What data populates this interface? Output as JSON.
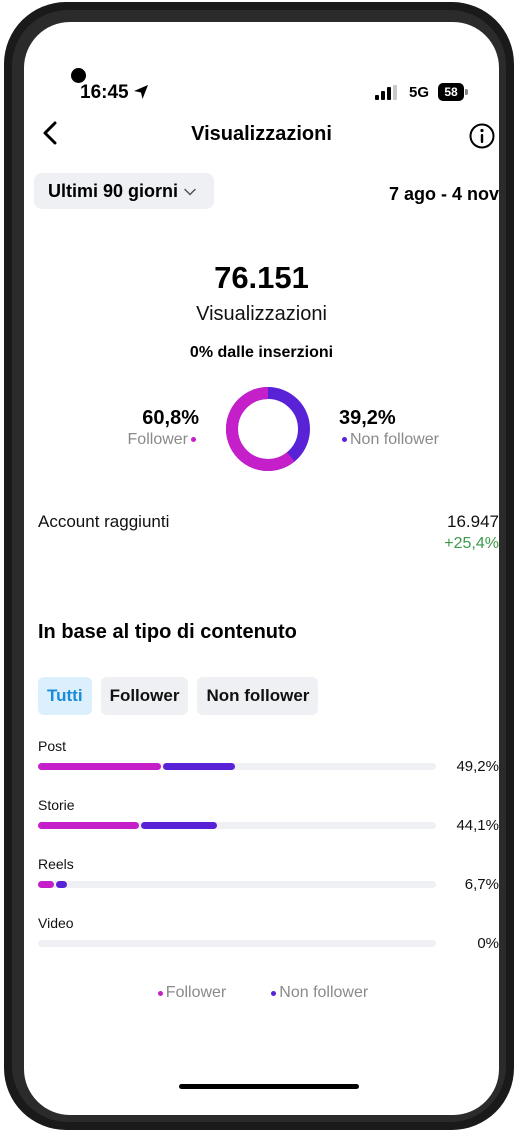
{
  "status_bar": {
    "time": "16:45",
    "network": "5G",
    "battery": "58"
  },
  "header": {
    "title": "Visualizzazioni"
  },
  "period": {
    "selected": "Ultimi 90 giorni",
    "date_range": "7 ago - 4 nov"
  },
  "summary": {
    "total": "76.151",
    "label": "Visualizzazioni",
    "ads_note": "0% dalle inserzioni",
    "follower_pct": "60,8%",
    "follower_label": "Follower",
    "non_follower_pct": "39,2%",
    "non_follower_label": "Non follower",
    "follower_fraction": 0.608
  },
  "reach": {
    "label": "Account raggiunti",
    "value": "16.947",
    "change": "+25,4%"
  },
  "content_section": {
    "title": "In base al tipo di contenuto",
    "tabs": [
      "Tutti",
      "Follower",
      "Non follower"
    ],
    "active_tab": "Tutti",
    "rows": [
      {
        "label": "Post",
        "pct": "49,2%",
        "follower_share": 0.31,
        "non_follower_share": 0.18
      },
      {
        "label": "Storie",
        "pct": "44,1%",
        "follower_share": 0.255,
        "non_follower_share": 0.19
      },
      {
        "label": "Reels",
        "pct": "6,7%",
        "follower_share": 0.04,
        "non_follower_share": 0.027
      },
      {
        "label": "Video",
        "pct": "0%",
        "follower_share": 0,
        "non_follower_share": 0
      }
    ]
  },
  "legend": {
    "follower": "Follower",
    "non_follower": "Non follower"
  },
  "colors": {
    "follower": "#c41fc9",
    "non_follower": "#5a22d6",
    "track": "#eef0f3",
    "positive": "#3a9a4a",
    "accent": "#1a8bd8"
  }
}
